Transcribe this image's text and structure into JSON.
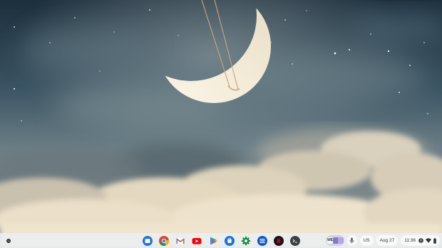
{
  "desktop": {
    "wallpaper": "night-sky-crescent-moon-swing-clouds",
    "colors": {
      "sky_top": "#1f3140",
      "sky_mid": "#4d6574",
      "moon": "#f1e8d6",
      "cloud": "#e9dcc4"
    }
  },
  "shelf": {
    "launcher": {
      "icon": "launcher-circle-icon"
    },
    "apps": [
      {
        "name": "files",
        "icon": "files-icon",
        "color": "#1a73e8"
      },
      {
        "name": "chrome",
        "icon": "chrome-icon",
        "color": "#4285f4"
      },
      {
        "name": "gmail",
        "icon": "gmail-icon",
        "color": "#ea4335"
      },
      {
        "name": "youtube",
        "icon": "youtube-icon",
        "color": "#ff0000"
      },
      {
        "name": "play-store",
        "icon": "play-store-icon",
        "color": "#34a853"
      },
      {
        "name": "web-store",
        "icon": "web-store-icon",
        "color": "#1a73e8"
      },
      {
        "name": "settings",
        "icon": "settings-gear-icon",
        "color": "#1e8e3e"
      },
      {
        "name": "app-list",
        "icon": "list-app-icon",
        "color": "#0b57d0"
      },
      {
        "name": "netflix",
        "icon": "netflix-icon",
        "color": "#e50914"
      },
      {
        "name": "terminal",
        "icon": "terminal-icon",
        "color": "#3c4043"
      }
    ]
  },
  "status": {
    "holding_space": {
      "label": "WE"
    },
    "ime": "US",
    "date": "Aug 27",
    "time": "11:36",
    "tray": [
      "notification-badge-icon",
      "wifi-icon",
      "battery-icon"
    ]
  }
}
